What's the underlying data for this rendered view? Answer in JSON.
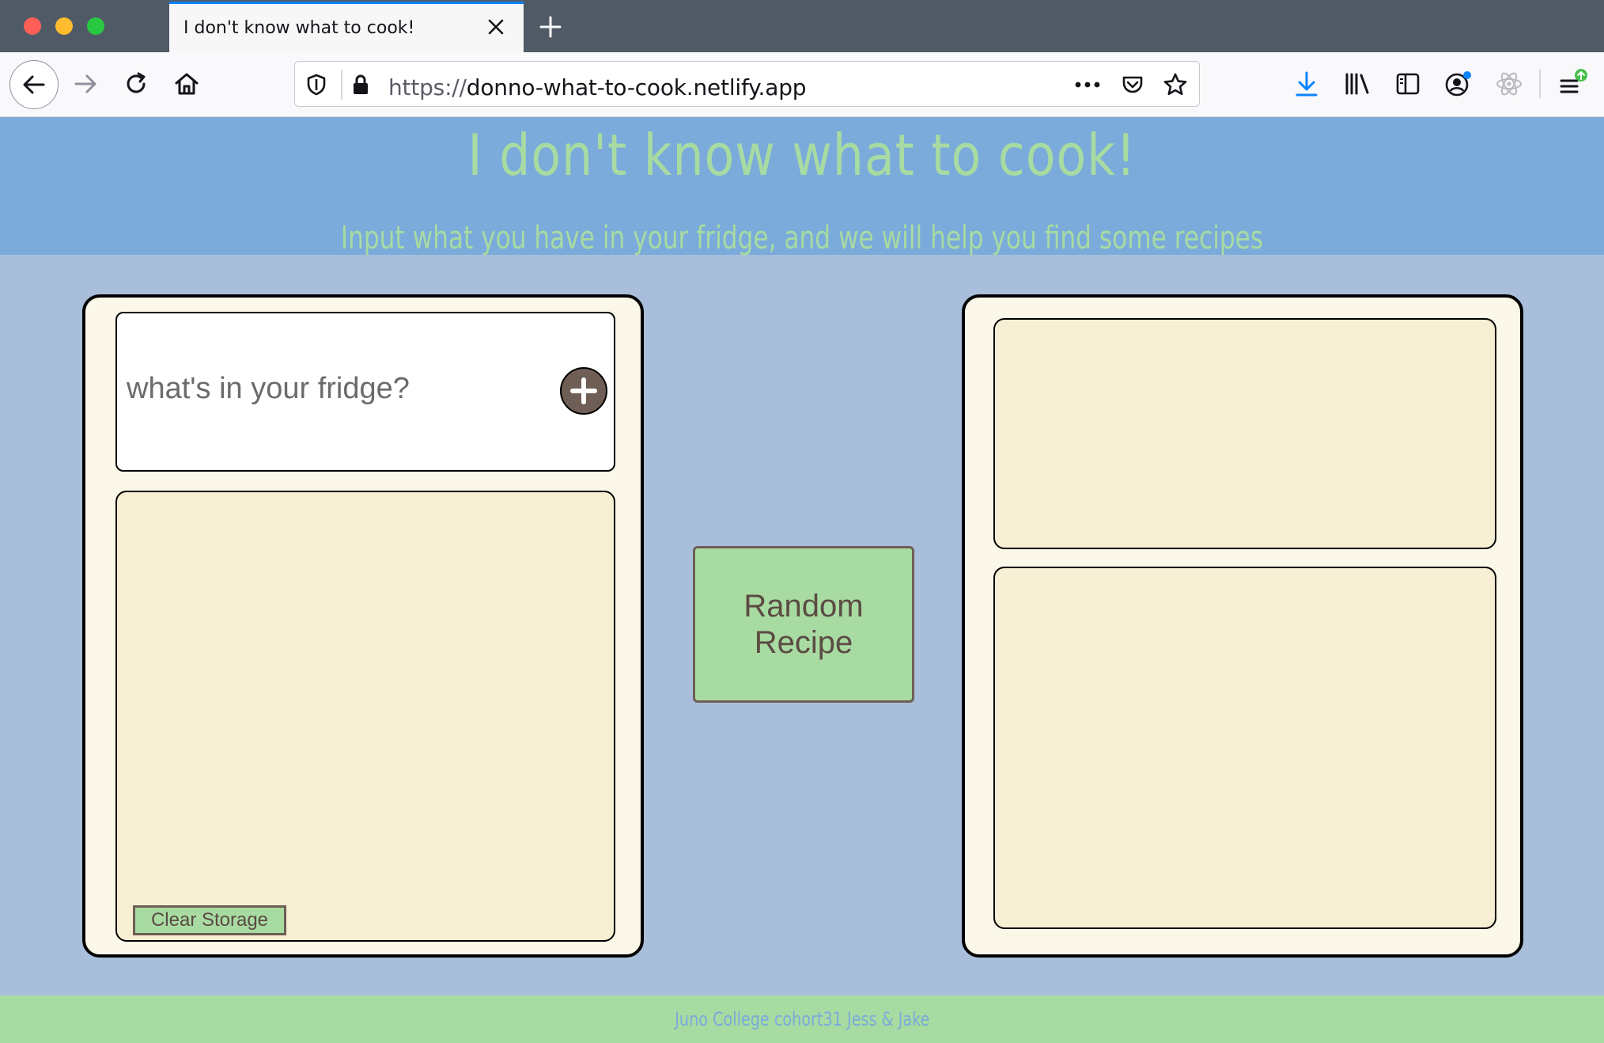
{
  "browser": {
    "tab_title": "I don't know what to cook!",
    "url_protocol": "https://",
    "url_host": "donno-what-to-cook.netlify.app",
    "icons": {
      "close_tab": "close-icon",
      "new_tab": "plus-icon",
      "back": "arrow-left-icon",
      "forward": "arrow-right-icon",
      "reload": "reload-icon",
      "home": "home-icon",
      "tracking": "shield-icon",
      "lock": "lock-icon",
      "page_actions": "more-icon",
      "pocket": "pocket-icon",
      "bookmark": "star-icon",
      "downloads": "download-icon",
      "library": "library-icon",
      "sidebar": "sidebar-icon",
      "account": "account-icon",
      "react_devtools": "react-icon",
      "menu": "hamburger-icon"
    }
  },
  "header": {
    "title": "I don't know what to cook!",
    "subtitle": "Input what you have in your fridge, and we will help you find some recipes"
  },
  "fridge": {
    "placeholder": "what's in your fridge?",
    "add_icon": "plus-icon",
    "clear_label": "Clear Storage"
  },
  "random_button": {
    "label": "Random Recipe"
  },
  "footer": {
    "text": "Juno College cohort31 Jess & Jake"
  },
  "colors": {
    "header_bg": "#7aabda",
    "page_bg": "#a9bedb",
    "accent_green": "#a8dba2",
    "card_bg": "#fbf8e9",
    "panel_bg": "#f6efd4",
    "brown": "#6f5e55"
  }
}
